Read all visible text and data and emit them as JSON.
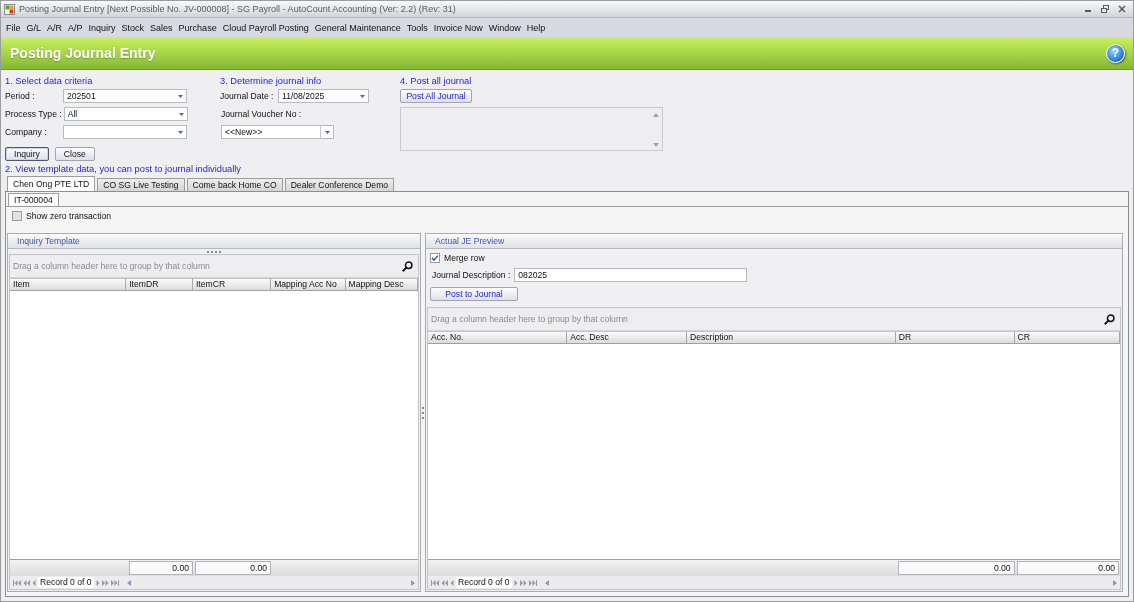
{
  "window": {
    "title": "Posting Journal Entry [Next Possible No. JV-000008] - SG Payroll - AutoCount Accounting (Ver: 2.2) (Rev: 31)"
  },
  "menu": [
    "File",
    "G/L",
    "A/R",
    "A/P",
    "Inquiry",
    "Stock",
    "Sales",
    "Purchase",
    "Cloud Payroll Posting",
    "General Maintenance",
    "Tools",
    "Invoice Now",
    "Window",
    "Help"
  ],
  "header": {
    "title": "Posting Journal Entry",
    "help_button": "?"
  },
  "criteria": {
    "heading": "1. Select data criteria",
    "fields": [
      {
        "label": "Period :",
        "value": "202501"
      },
      {
        "label": "Process Type :",
        "value": "All"
      },
      {
        "label": "Company :"
      }
    ],
    "buttons": [
      {
        "label": "Inquiry",
        "focused": true
      },
      {
        "label": "Close",
        "focused": false
      }
    ]
  },
  "journal_info": {
    "heading": "3. Determine journal info",
    "date": {
      "label": "Journal Date :",
      "value": "11/08/2025"
    },
    "voucher": {
      "label": "Journal Voucher No :",
      "value": "<<New>>"
    }
  },
  "post_all": {
    "heading": "4. Post all journal",
    "button": "Post All Journal"
  },
  "template": {
    "heading": "2. View template data, you can post to journal individually",
    "tabs": [
      {
        "label": "Chen Ong PTE LTD",
        "selected": true
      },
      {
        "label": "CO SG Live Testing",
        "selected": false
      },
      {
        "label": "Come back Home CO",
        "selected": false
      },
      {
        "label": "Dealer Conference Demo",
        "selected": false
      }
    ],
    "sub_tabs": [
      {
        "label": "IT-000004",
        "selected": true
      }
    ],
    "show_zero": {
      "label": "Show zero transaction",
      "checked": false
    },
    "panels": [
      {
        "kind": "inquiry",
        "title": "Inquiry Template",
        "group_hint": "Drag a column header here to group by that column",
        "columns": [
          {
            "label": "Item"
          },
          {
            "label": "ItemDR",
            "total": "0.00"
          },
          {
            "label": "ItemCR",
            "total": "0.00"
          },
          {
            "label": "Mapping Acc No"
          },
          {
            "label": "Mapping Desc"
          }
        ],
        "record": "Record 0 of 0"
      },
      {
        "kind": "preview",
        "title": "Actual JE Preview",
        "merge_row": {
          "label": "Merge row",
          "checked": true
        },
        "description": {
          "label": "Journal Description :",
          "value": "082025"
        },
        "button": "Post to Journal",
        "group_hint": "Drag a column header here to group by that column",
        "columns": [
          {
            "label": "Acc. No."
          },
          {
            "label": "Acc. Desc"
          },
          {
            "label": "Description"
          },
          {
            "label": "DR",
            "total": "0.00"
          },
          {
            "label": "CR",
            "total": "0.00"
          }
        ],
        "record": "Record 0 of 0"
      }
    ]
  }
}
